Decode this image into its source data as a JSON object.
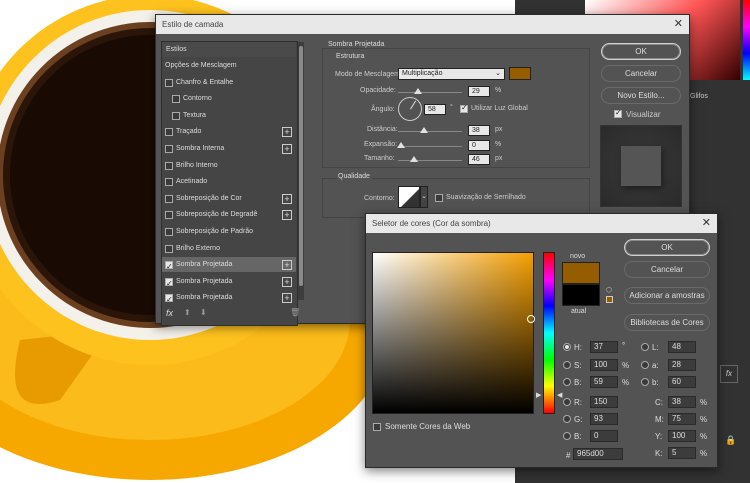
{
  "layer_style": {
    "title": "Estilo de camada",
    "list": {
      "header": "Estilos",
      "items": [
        {
          "label": "Opções de Mesclagem",
          "checkbox": false,
          "checked": false,
          "plus": false,
          "indent": false
        },
        {
          "label": "Chanfro & Entalhe",
          "checkbox": true,
          "checked": false,
          "plus": false,
          "indent": false
        },
        {
          "label": "Contorno",
          "checkbox": true,
          "checked": false,
          "plus": false,
          "indent": true
        },
        {
          "label": "Textura",
          "checkbox": true,
          "checked": false,
          "plus": false,
          "indent": true
        },
        {
          "label": "Traçado",
          "checkbox": true,
          "checked": false,
          "plus": true,
          "indent": false
        },
        {
          "label": "Sombra Interna",
          "checkbox": true,
          "checked": false,
          "plus": true,
          "indent": false
        },
        {
          "label": "Brilho Interno",
          "checkbox": true,
          "checked": false,
          "plus": false,
          "indent": false
        },
        {
          "label": "Acetinado",
          "checkbox": true,
          "checked": false,
          "plus": false,
          "indent": false
        },
        {
          "label": "Sobreposição de Cor",
          "checkbox": true,
          "checked": false,
          "plus": true,
          "indent": false
        },
        {
          "label": "Sobreposição de Degradê",
          "checkbox": true,
          "checked": false,
          "plus": true,
          "indent": false
        },
        {
          "label": "Sobreposição de Padrão",
          "checkbox": true,
          "checked": false,
          "plus": false,
          "indent": false
        },
        {
          "label": "Brilho Externo",
          "checkbox": true,
          "checked": false,
          "plus": false,
          "indent": false
        },
        {
          "label": "Sombra Projetada",
          "checkbox": true,
          "checked": true,
          "plus": true,
          "indent": false,
          "selected": true
        },
        {
          "label": "Sombra Projetada",
          "checkbox": true,
          "checked": true,
          "plus": true,
          "indent": false
        },
        {
          "label": "Sombra Projetada",
          "checkbox": true,
          "checked": true,
          "plus": true,
          "indent": false
        }
      ],
      "fx_label": "fx"
    },
    "panel": {
      "section_title": "Sombra Projetada",
      "structure_title": "Estrutura",
      "blend_label": "Modo de Mesclagem:",
      "blend_value": "Multiplicação",
      "opacity_label": "Opacidade:",
      "opacity_value": "29",
      "angle_label": "Ângulo:",
      "angle_value": "58",
      "global_light_label": "Utilizar Luz Global",
      "distance_label": "Distância:",
      "distance_value": "38",
      "spread_label": "Expansão:",
      "spread_value": "0",
      "size_label": "Tamanho:",
      "size_value": "46",
      "unit_percent": "%",
      "unit_px": "px",
      "unit_deg": "°",
      "quality_title": "Qualidade",
      "contour_label": "Contorno:",
      "antialias_label": "Suavização de Serrilhado",
      "shadow_color": "#965d00"
    },
    "buttons": {
      "ok": "OK",
      "cancel": "Cancelar",
      "new_style": "Novo Estilo...",
      "preview": "Visualizar"
    }
  },
  "color_picker": {
    "title": "Seletor de cores (Cor da sombra)",
    "new_label": "novo",
    "current_label": "atual",
    "new_color": "#965d00",
    "current_color": "#000000",
    "web_only_label": "Somente Cores da Web",
    "buttons": {
      "ok": "OK",
      "cancel": "Cancelar",
      "add_swatches": "Adicionar a amostras",
      "libraries": "Bibliotecas de Cores"
    },
    "fields": {
      "h": {
        "label": "H:",
        "value": "37",
        "unit": "°"
      },
      "s": {
        "label": "S:",
        "value": "100",
        "unit": "%"
      },
      "b": {
        "label": "B:",
        "value": "59",
        "unit": "%"
      },
      "r": {
        "label": "R:",
        "value": "150"
      },
      "g": {
        "label": "G:",
        "value": "93"
      },
      "bb": {
        "label": "B:",
        "value": "0"
      },
      "l": {
        "label": "L:",
        "value": "48"
      },
      "a": {
        "label": "a:",
        "value": "28"
      },
      "lab_b": {
        "label": "b:",
        "value": "60"
      },
      "c": {
        "label": "C:",
        "value": "38",
        "unit": "%"
      },
      "m": {
        "label": "M:",
        "value": "75",
        "unit": "%"
      },
      "y": {
        "label": "Y:",
        "value": "100",
        "unit": "%"
      },
      "k": {
        "label": "K:",
        "value": "5",
        "unit": "%"
      },
      "hex_label": "#",
      "hex": "965d00"
    }
  },
  "ps_panel": {
    "tab_glyphs": "Glifos"
  }
}
